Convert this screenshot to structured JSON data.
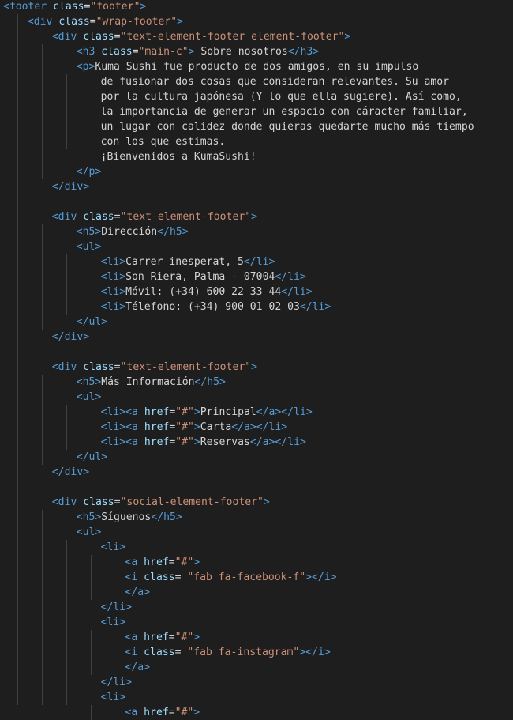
{
  "lines": [
    [
      {
        "t": "tag",
        "v": "<footer"
      },
      {
        "t": "text",
        "v": " "
      },
      {
        "t": "attr",
        "v": "class"
      },
      {
        "t": "text",
        "v": "="
      },
      {
        "t": "str",
        "v": "\"footer\""
      },
      {
        "t": "tag",
        "v": ">"
      }
    ],
    [
      {
        "t": "tag",
        "v": "<div"
      },
      {
        "t": "text",
        "v": " "
      },
      {
        "t": "attr",
        "v": "class"
      },
      {
        "t": "text",
        "v": "="
      },
      {
        "t": "str",
        "v": "\"wrap-footer\""
      },
      {
        "t": "tag",
        "v": ">"
      }
    ],
    [
      {
        "t": "tag",
        "v": "<div"
      },
      {
        "t": "text",
        "v": " "
      },
      {
        "t": "attr",
        "v": "class"
      },
      {
        "t": "text",
        "v": "="
      },
      {
        "t": "str",
        "v": "\"text-element-footer element-footer\""
      },
      {
        "t": "tag",
        "v": ">"
      }
    ],
    [
      {
        "t": "tag",
        "v": "<h3"
      },
      {
        "t": "text",
        "v": " "
      },
      {
        "t": "attr",
        "v": "class"
      },
      {
        "t": "text",
        "v": "="
      },
      {
        "t": "str",
        "v": "\"main-c\""
      },
      {
        "t": "tag",
        "v": ">"
      },
      {
        "t": "text",
        "v": " Sobre nosotros"
      },
      {
        "t": "tag",
        "v": "</h3>"
      }
    ],
    [
      {
        "t": "tag",
        "v": "<p>"
      },
      {
        "t": "text",
        "v": "Kuma Sushi fue producto de dos amigos, en su impulso"
      }
    ],
    [
      {
        "t": "text",
        "v": "de fusionar dos cosas que consideran relevantes. Su amor"
      }
    ],
    [
      {
        "t": "text",
        "v": "por la cultura japónesa (Y lo que ella sugiere). Así como,"
      }
    ],
    [
      {
        "t": "text",
        "v": "la importancia de generar un espacio con cáracter familiar,"
      }
    ],
    [
      {
        "t": "text",
        "v": "un lugar con calidez donde quieras quedarte mucho más tiempo"
      }
    ],
    [
      {
        "t": "text",
        "v": "con los que estimas."
      }
    ],
    [
      {
        "t": "text",
        "v": "¡Bienvenidos a KumaSushi!"
      }
    ],
    [
      {
        "t": "tag",
        "v": "</p>"
      }
    ],
    [
      {
        "t": "tag",
        "v": "</div>"
      }
    ],
    [],
    [
      {
        "t": "tag",
        "v": "<div"
      },
      {
        "t": "text",
        "v": " "
      },
      {
        "t": "attr",
        "v": "class"
      },
      {
        "t": "text",
        "v": "="
      },
      {
        "t": "str",
        "v": "\"text-element-footer\""
      },
      {
        "t": "tag",
        "v": ">"
      }
    ],
    [
      {
        "t": "tag",
        "v": "<h5>"
      },
      {
        "t": "text",
        "v": "Dirección"
      },
      {
        "t": "tag",
        "v": "</h5>"
      }
    ],
    [
      {
        "t": "tag",
        "v": "<ul>"
      }
    ],
    [
      {
        "t": "tag",
        "v": "<li>"
      },
      {
        "t": "text",
        "v": "Carrer inesperat, 5"
      },
      {
        "t": "tag",
        "v": "</li>"
      }
    ],
    [
      {
        "t": "tag",
        "v": "<li>"
      },
      {
        "t": "text",
        "v": "Son Riera, Palma - 07004"
      },
      {
        "t": "tag",
        "v": "</li>"
      }
    ],
    [
      {
        "t": "tag",
        "v": "<li>"
      },
      {
        "t": "text",
        "v": "Móvil: (+34) 600 22 33 44"
      },
      {
        "t": "tag",
        "v": "</li>"
      }
    ],
    [
      {
        "t": "tag",
        "v": "<li>"
      },
      {
        "t": "text",
        "v": "Télefono: (+34) 900 01 02 03"
      },
      {
        "t": "tag",
        "v": "</li>"
      }
    ],
    [
      {
        "t": "tag",
        "v": "</ul>"
      }
    ],
    [
      {
        "t": "tag",
        "v": "</div>"
      }
    ],
    [],
    [
      {
        "t": "tag",
        "v": "<div"
      },
      {
        "t": "text",
        "v": " "
      },
      {
        "t": "attr",
        "v": "class"
      },
      {
        "t": "text",
        "v": "="
      },
      {
        "t": "str",
        "v": "\"text-element-footer\""
      },
      {
        "t": "tag",
        "v": ">"
      }
    ],
    [
      {
        "t": "tag",
        "v": "<h5>"
      },
      {
        "t": "text",
        "v": "Más Información"
      },
      {
        "t": "tag",
        "v": "</h5>"
      }
    ],
    [
      {
        "t": "tag",
        "v": "<ul>"
      }
    ],
    [
      {
        "t": "tag",
        "v": "<li>"
      },
      {
        "t": "tag",
        "v": "<a"
      },
      {
        "t": "text",
        "v": " "
      },
      {
        "t": "attr",
        "v": "href"
      },
      {
        "t": "text",
        "v": "="
      },
      {
        "t": "str",
        "v": "\"#\""
      },
      {
        "t": "tag",
        "v": ">"
      },
      {
        "t": "text",
        "v": "Principal"
      },
      {
        "t": "tag",
        "v": "</a>"
      },
      {
        "t": "tag",
        "v": "</li>"
      }
    ],
    [
      {
        "t": "tag",
        "v": "<li>"
      },
      {
        "t": "tag",
        "v": "<a"
      },
      {
        "t": "text",
        "v": " "
      },
      {
        "t": "attr",
        "v": "href"
      },
      {
        "t": "text",
        "v": "="
      },
      {
        "t": "str",
        "v": "\"#\""
      },
      {
        "t": "tag",
        "v": ">"
      },
      {
        "t": "text",
        "v": "Carta"
      },
      {
        "t": "tag",
        "v": "</a>"
      },
      {
        "t": "tag",
        "v": "</li>"
      }
    ],
    [
      {
        "t": "tag",
        "v": "<li>"
      },
      {
        "t": "tag",
        "v": "<a"
      },
      {
        "t": "text",
        "v": " "
      },
      {
        "t": "attr",
        "v": "href"
      },
      {
        "t": "text",
        "v": "="
      },
      {
        "t": "str",
        "v": "\"#\""
      },
      {
        "t": "tag",
        "v": ">"
      },
      {
        "t": "text",
        "v": "Reservas"
      },
      {
        "t": "tag",
        "v": "</a>"
      },
      {
        "t": "tag",
        "v": "</li>"
      }
    ],
    [
      {
        "t": "tag",
        "v": "</ul>"
      }
    ],
    [
      {
        "t": "tag",
        "v": "</div>"
      }
    ],
    [],
    [
      {
        "t": "tag",
        "v": "<div"
      },
      {
        "t": "text",
        "v": " "
      },
      {
        "t": "attr",
        "v": "class"
      },
      {
        "t": "text",
        "v": "="
      },
      {
        "t": "str",
        "v": "\"social-element-footer\""
      },
      {
        "t": "tag",
        "v": ">"
      }
    ],
    [
      {
        "t": "tag",
        "v": "<h5>"
      },
      {
        "t": "text",
        "v": "Síguenos"
      },
      {
        "t": "tag",
        "v": "</h5>"
      }
    ],
    [
      {
        "t": "tag",
        "v": "<ul>"
      }
    ],
    [
      {
        "t": "tag",
        "v": "<li>"
      }
    ],
    [
      {
        "t": "tag",
        "v": "<a"
      },
      {
        "t": "text",
        "v": " "
      },
      {
        "t": "attr",
        "v": "href"
      },
      {
        "t": "text",
        "v": "="
      },
      {
        "t": "str",
        "v": "\"#\""
      },
      {
        "t": "tag",
        "v": ">"
      }
    ],
    [
      {
        "t": "tag",
        "v": "<i"
      },
      {
        "t": "text",
        "v": " "
      },
      {
        "t": "attr",
        "v": "class"
      },
      {
        "t": "text",
        "v": "= "
      },
      {
        "t": "str",
        "v": "\"fab fa-facebook-f\""
      },
      {
        "t": "tag",
        "v": ">"
      },
      {
        "t": "tag",
        "v": "</i>"
      }
    ],
    [
      {
        "t": "tag",
        "v": "</a>"
      }
    ],
    [
      {
        "t": "tag",
        "v": "</li>"
      }
    ],
    [
      {
        "t": "tag",
        "v": "<li>"
      }
    ],
    [
      {
        "t": "tag",
        "v": "<a"
      },
      {
        "t": "text",
        "v": " "
      },
      {
        "t": "attr",
        "v": "href"
      },
      {
        "t": "text",
        "v": "="
      },
      {
        "t": "str",
        "v": "\"#\""
      },
      {
        "t": "tag",
        "v": ">"
      }
    ],
    [
      {
        "t": "tag",
        "v": "<i"
      },
      {
        "t": "text",
        "v": " "
      },
      {
        "t": "attr",
        "v": "class"
      },
      {
        "t": "text",
        "v": "= "
      },
      {
        "t": "str",
        "v": "\"fab fa-instagram\""
      },
      {
        "t": "tag",
        "v": ">"
      },
      {
        "t": "tag",
        "v": "</i>"
      }
    ],
    [
      {
        "t": "tag",
        "v": "</a>"
      }
    ],
    [
      {
        "t": "tag",
        "v": "</li>"
      }
    ],
    [
      {
        "t": "tag",
        "v": "<li>"
      }
    ],
    [
      {
        "t": "tag",
        "v": "<a"
      },
      {
        "t": "text",
        "v": " "
      },
      {
        "t": "attr",
        "v": "href"
      },
      {
        "t": "text",
        "v": "="
      },
      {
        "t": "str",
        "v": "\"#\""
      },
      {
        "t": "tag",
        "v": ">"
      }
    ]
  ],
  "colors": {
    "background": "#1e1e1e",
    "tag": "#569cd6",
    "bracket": "#808080",
    "attribute": "#9cdcfe",
    "string": "#ce9178",
    "text": "#d4d4d4",
    "indent_guide": "#404040"
  }
}
